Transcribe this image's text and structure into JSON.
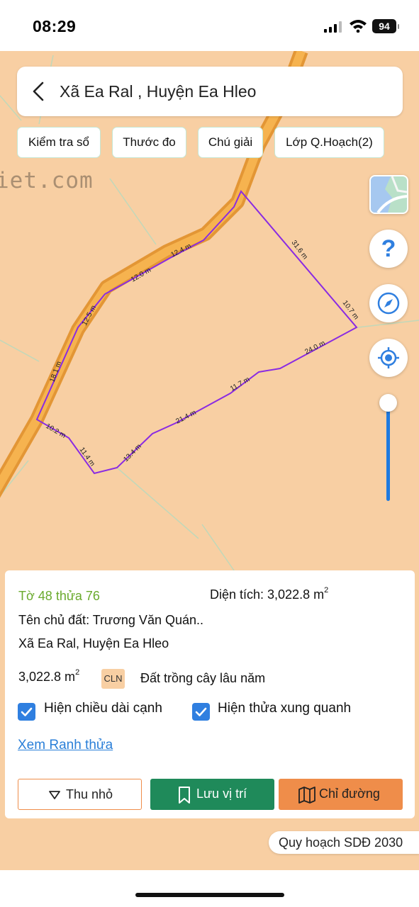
{
  "status_bar": {
    "time": "08:29",
    "battery": "94"
  },
  "map": {
    "watermark": "iet.com",
    "search": {
      "location": "Xã Ea Ral , Huyện Ea Hleo"
    },
    "toolbar": [
      "Kiểm tra sổ",
      "Thước đo",
      "Chú giải",
      "Lớp Q.Hoạch(2)"
    ],
    "edge_lengths": [
      "31.6 m",
      "10.7 m",
      "24.0 m",
      "11.7 m",
      "21.4 m",
      "13.4 m",
      "11.4 m",
      "10.2 m",
      "18.1 m",
      "12.5 m",
      "12.0 m",
      "12.4 m"
    ],
    "colors": {
      "land_fill": "#f8cfa3",
      "parcel_border": "#8a2be2",
      "road": "#f3a63c",
      "accent": "#1e7ae0"
    }
  },
  "info_panel": {
    "parcel_id": "Tờ 48 thửa 76",
    "area_label": "Diện tích: 3,022.8 m",
    "area_sup": "2",
    "owner": "Tên chủ đất: Trương Văn Quán..",
    "address": "Xã Ea Ral, Huyện Ea Hleo",
    "area_value": "3,022.8 m",
    "land_code": "CLN",
    "land_type": "Đất trồng cây lâu năm",
    "checkbox_edges": "Hiện chiều dài cạnh",
    "checkbox_neighbors": "Hiện thửa xung quanh",
    "link_boundary": "Xem Ranh thửa",
    "buttons": {
      "shrink": "Thu nhỏ",
      "save": "Lưu vị trí",
      "route": "Chỉ đường"
    }
  },
  "plan_label": "Quy hoạch SDĐ 2030"
}
